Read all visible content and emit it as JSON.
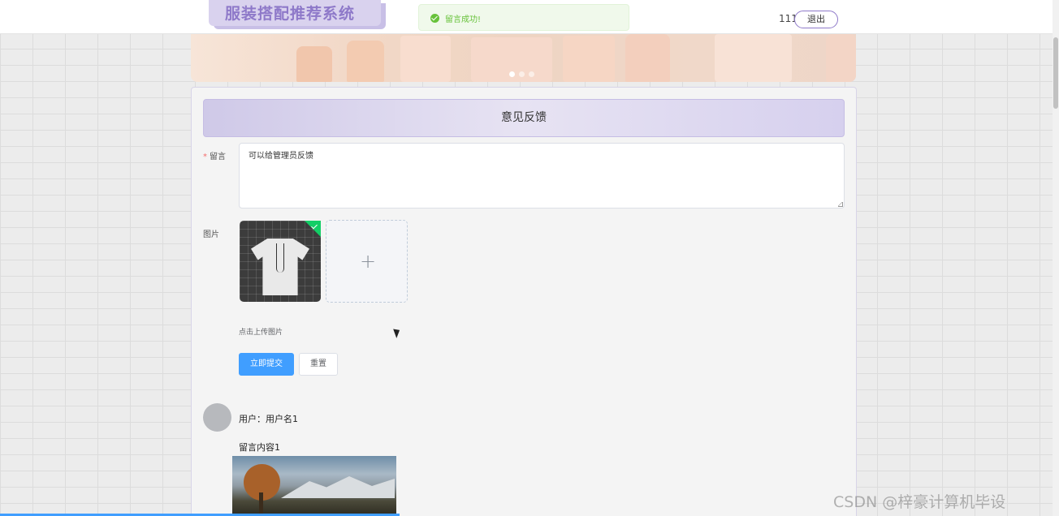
{
  "app": {
    "title": "服装搭配推荐系统"
  },
  "toast": {
    "text": "留言成功!"
  },
  "header": {
    "username": "111",
    "logout_label": "退出"
  },
  "banner": {
    "dots": 3,
    "active_dot": 1
  },
  "section": {
    "title": "意见反馈"
  },
  "form": {
    "message_label": "留言",
    "message_value": "可以给管理员反馈",
    "image_label": "图片",
    "upload_hint": "点击上传图片",
    "submit_label": "立即提交",
    "reset_label": "重置"
  },
  "comments": [
    {
      "user_line": "用户：用户名1",
      "content": "留言内容1"
    }
  ],
  "watermark": "CSDN @梓豪计算机毕设",
  "colors": {
    "primary": "#409eff",
    "accent": "#8e79c9",
    "success": "#67c23a"
  }
}
